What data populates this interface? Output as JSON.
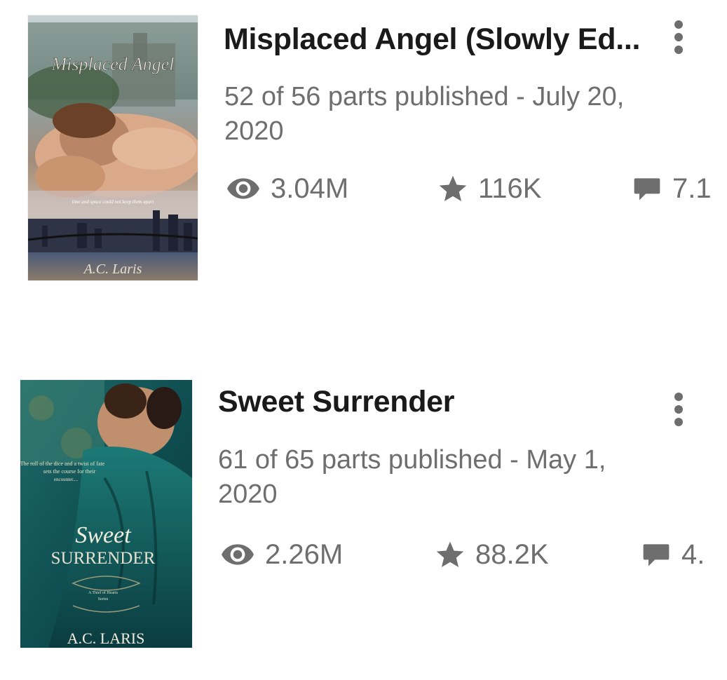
{
  "stories": [
    {
      "title": "Misplaced Angel (Slowly Ed...",
      "meta_line1": "52 of 56 parts published - July 20,",
      "meta_line2": "2020",
      "reads": "3.04M",
      "votes": "116K",
      "comments": "7.1",
      "cover": {
        "title_text": "Misplaced Angel",
        "tagline": "time and space could not keep them apart",
        "author": "A.C. Laris"
      }
    },
    {
      "title": "Sweet Surrender",
      "meta_line1": "61 of 65 parts published - May 1,",
      "meta_line2": "2020",
      "reads": "2.26M",
      "votes": "88.2K",
      "comments": "4.",
      "cover": {
        "tagline_1": "The roll of the dice and a twist of fate",
        "tagline_2": "sets the course for their",
        "tagline_3": "encounter....",
        "title_top": "Sweet",
        "title_bottom": "SURRENDER",
        "series_1": "A Thief of Hearts",
        "series_2": "Series",
        "author": "A.C. LARIS"
      }
    }
  ],
  "icons": {
    "reads": "eye-icon",
    "votes": "star-icon",
    "comments": "comment-icon",
    "menu": "more-vertical-icon"
  },
  "colors": {
    "text_primary": "#1a1a1a",
    "text_secondary": "#6e6e6e"
  }
}
